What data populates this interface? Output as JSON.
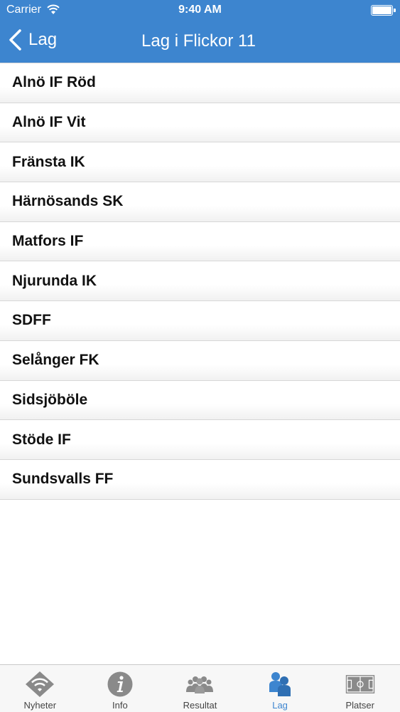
{
  "status_bar": {
    "carrier": "Carrier",
    "time": "9:40 AM"
  },
  "nav": {
    "back_label": "Lag",
    "title": "Lag i Flickor 11"
  },
  "teams": [
    "Alnö IF Röd",
    "Alnö IF Vit",
    "Fränsta IK",
    "Härnösands SK",
    "Matfors IF",
    "Njurunda IK",
    "SDFF",
    "Selånger FK",
    "Sidsjöböle",
    "Stöde IF",
    "Sundsvalls FF"
  ],
  "tabs": [
    {
      "label": "Nyheter",
      "icon": "wifi-diamond-icon"
    },
    {
      "label": "Info",
      "icon": "info-icon"
    },
    {
      "label": "Resultat",
      "icon": "group-icon"
    },
    {
      "label": "Lag",
      "icon": "team-icon",
      "active": true
    },
    {
      "label": "Platser",
      "icon": "field-icon"
    }
  ],
  "colors": {
    "accent": "#3d85cf",
    "tab_inactive": "#8a8a8a"
  }
}
